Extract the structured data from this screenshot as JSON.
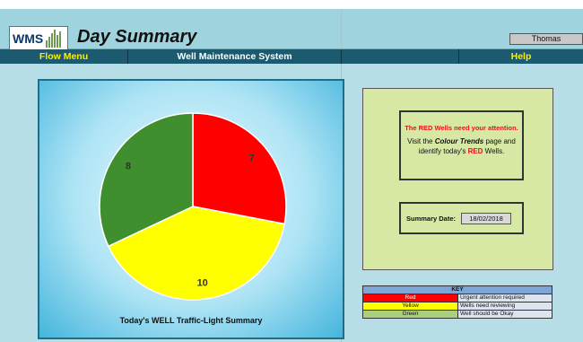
{
  "app": {
    "logo_text": "WMS",
    "title": "Day Summary",
    "user": "Thomas"
  },
  "nav": {
    "flow_menu": "Flow Menu",
    "system_name": "Well Maintenance System",
    "help": "Help"
  },
  "chart_data": {
    "type": "pie",
    "title": "Today's WELL Traffic-Light Summary",
    "slices": [
      {
        "label": "Red",
        "value": 7,
        "color": "#ff0000"
      },
      {
        "label": "Yellow",
        "value": 10,
        "color": "#ffff00"
      },
      {
        "label": "Green",
        "value": 8,
        "color": "#3f8f2f"
      }
    ],
    "data_labels": [
      "7",
      "10",
      "8"
    ]
  },
  "message": {
    "line1": "The RED Wells need your attention.",
    "line2_pre": "Visit the ",
    "line2_em": "Colour Trends",
    "line2_post": "  page and",
    "line3_pre": "identify today's ",
    "line3_red": "RED",
    "line3_post": " Wells."
  },
  "summary": {
    "date_label": "Summary Date:",
    "date_value": "18/02/2018"
  },
  "key": {
    "header": "KEY",
    "rows": [
      {
        "name": "Red",
        "desc": "Urgent attention required",
        "color": "#ff0000",
        "text_color": "#ffffff"
      },
      {
        "name": "Yellow",
        "desc": "Wells need reviewing",
        "color": "#ffff00",
        "text_color": "#111111"
      },
      {
        "name": "Green",
        "desc": "Well should be Okay",
        "color": "#a9cf7f",
        "text_color": "#111111"
      }
    ]
  }
}
